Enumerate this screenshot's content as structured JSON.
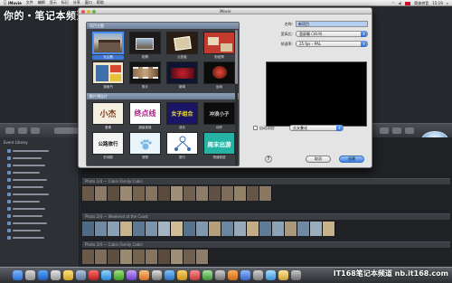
{
  "menubar": {
    "items": [
      "iMovie",
      "文件",
      "编辑",
      "显示",
      "标记",
      "分享",
      "窗口",
      "帮助"
    ],
    "flag_label": "简体拼音",
    "time": "15:19"
  },
  "watermark": {
    "top": "你的・笔记本频道 nb.it168.com",
    "dock": "IT168笔记本频道 nb.it168.com"
  },
  "background": {
    "library_title": "Event Library",
    "clip_rows": [
      "Photo 1/4 — Cabin Family Cabin",
      "Photo 2/4 — Weekend at the Coast",
      "Photo 3/4 — Cabin Family Cabin"
    ]
  },
  "dialog": {
    "title": "iMovie",
    "project_themes_header": "项目主题",
    "movie_trailers_header": "影片预告片",
    "themes": [
      {
        "label": "无主题",
        "selected": true
      },
      {
        "label": "相簿",
        "selected": false
      },
      {
        "label": "公告板",
        "selected": false
      },
      {
        "label": "剪贴簿",
        "selected": false
      },
      {
        "label": "漫画书",
        "selected": false
      },
      {
        "label": "胶片",
        "selected": false
      },
      {
        "label": "新闻",
        "selected": false
      },
      {
        "label": "运动",
        "selected": false
      }
    ],
    "trailers": [
      {
        "label": "爱情",
        "art": "小杰"
      },
      {
        "label": "超级英雄",
        "art": "终点线"
      },
      {
        "label": "成长",
        "art": "女子组合"
      },
      {
        "label": "动作",
        "art": "冲浪小子"
      },
      {
        "label": "史诗剧",
        "art": "公路旅行"
      },
      {
        "label": "宠物",
        "art": "pawprint"
      },
      {
        "label": "旅行",
        "art": "diagram"
      },
      {
        "label": "快速前进",
        "art": "周末出游"
      }
    ],
    "form": {
      "name_label": "名称:",
      "name_value": "新项目",
      "aspect_label": "宽高比:",
      "aspect_value": "宽屏幕 (16:9)",
      "framerate_label": "帧速率:",
      "framerate_value": "25 fps – PAL"
    },
    "auto_add_label": "自动添加:",
    "auto_add_value": "交叉叠化",
    "help_label": "?",
    "cancel_label": "取消",
    "create_label": "创建"
  },
  "colors": {
    "accent": "#3f75d6",
    "section_header": "#7f91ab",
    "dialog_bg": "#e4e4e4"
  }
}
